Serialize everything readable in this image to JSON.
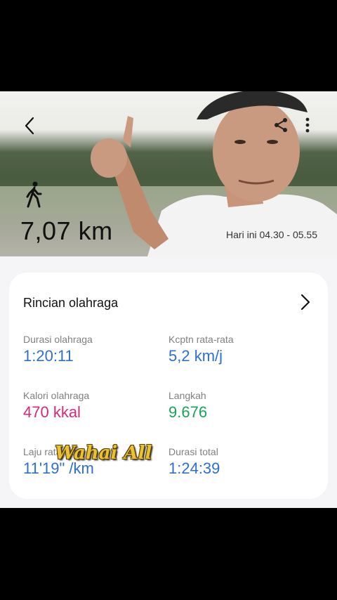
{
  "hero": {
    "distance": "7,07 km",
    "time_range": "Hari ini 04.30 - 05.55",
    "icons": {
      "back": "chevron-left-icon",
      "share": "share-icon",
      "more": "more-vertical-icon",
      "activity": "walking-icon"
    }
  },
  "details": {
    "title": "Rincian olahraga",
    "stats": [
      {
        "label": "Durasi olahraga",
        "value": "1:20:11",
        "color": "#2d6fd1"
      },
      {
        "label": "Kcptn rata-rata",
        "value": "5,2 km/j",
        "color": "#2d6fd1"
      },
      {
        "label": "Kalori olahraga",
        "value": "470 kkal",
        "color": "#d6297a"
      },
      {
        "label": "Langkah",
        "value": "9.676",
        "color": "#19a35a"
      },
      {
        "label": "Laju rata-rata",
        "value": "11'19\" /km",
        "color": "#2d6fd1"
      },
      {
        "label": "Durasi total",
        "value": "1:24:39",
        "color": "#2d6fd1"
      }
    ]
  },
  "overlay": {
    "watermark": "Wahai All"
  }
}
